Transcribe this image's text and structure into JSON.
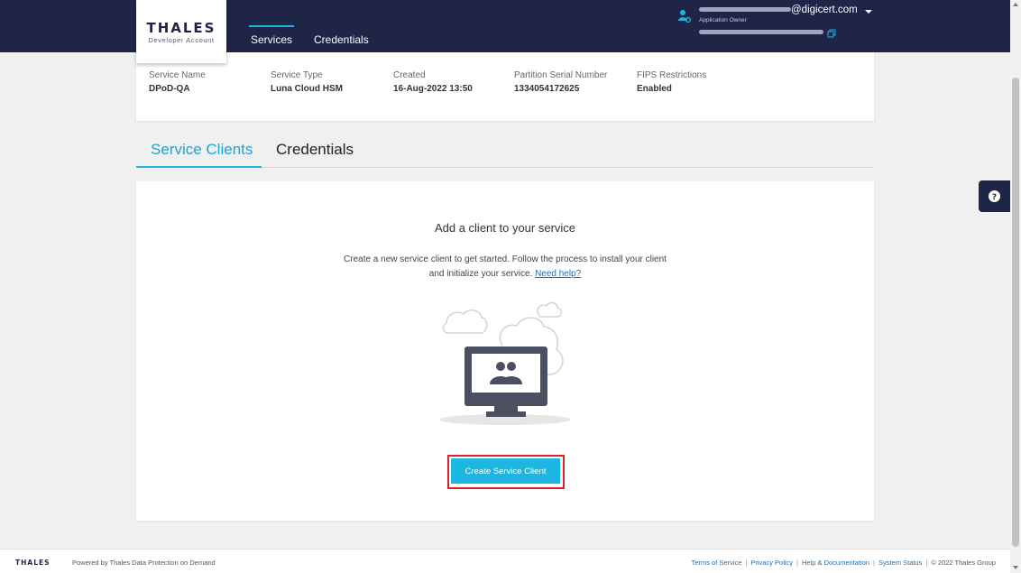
{
  "header": {
    "logo_main": "THALES",
    "logo_sub": "Developer Account",
    "nav": [
      {
        "label": "Services",
        "active": true
      },
      {
        "label": "Credentials",
        "active": false
      }
    ],
    "user": {
      "email_suffix": "@digicert.com",
      "role": "Application Owner"
    }
  },
  "service_info": {
    "fields": [
      {
        "label": "Service Name",
        "value": "DPoD-QA"
      },
      {
        "label": "Service Type",
        "value": "Luna Cloud HSM"
      },
      {
        "label": "Created",
        "value": "16-Aug-2022 13:50"
      },
      {
        "label": "Partition Serial Number",
        "value": "1334054172625"
      },
      {
        "label": "FIPS Restrictions",
        "value": "Enabled"
      }
    ]
  },
  "tabs": [
    {
      "label": "Service Clients",
      "active": true
    },
    {
      "label": "Credentials",
      "active": false
    }
  ],
  "empty_state": {
    "title": "Add a client to your service",
    "desc_line1": "Create a new service client to get started. Follow the process to install your client",
    "desc_line2": "and initialize your service.",
    "help_link": "Need help?",
    "button": "Create Service Client"
  },
  "help_widget_icon": "question-icon",
  "footer": {
    "logo": "THALES",
    "powered": "Powered by Thales Data Protection on Demand",
    "links": [
      "Terms of Service",
      "Privacy Policy",
      "Help & Documentation",
      "System Status"
    ],
    "copyright": "© 2022 Thales Group"
  },
  "colors": {
    "header_bg": "#1f2547",
    "accent": "#1fb5e0",
    "highlight_outline": "#d9222a"
  }
}
